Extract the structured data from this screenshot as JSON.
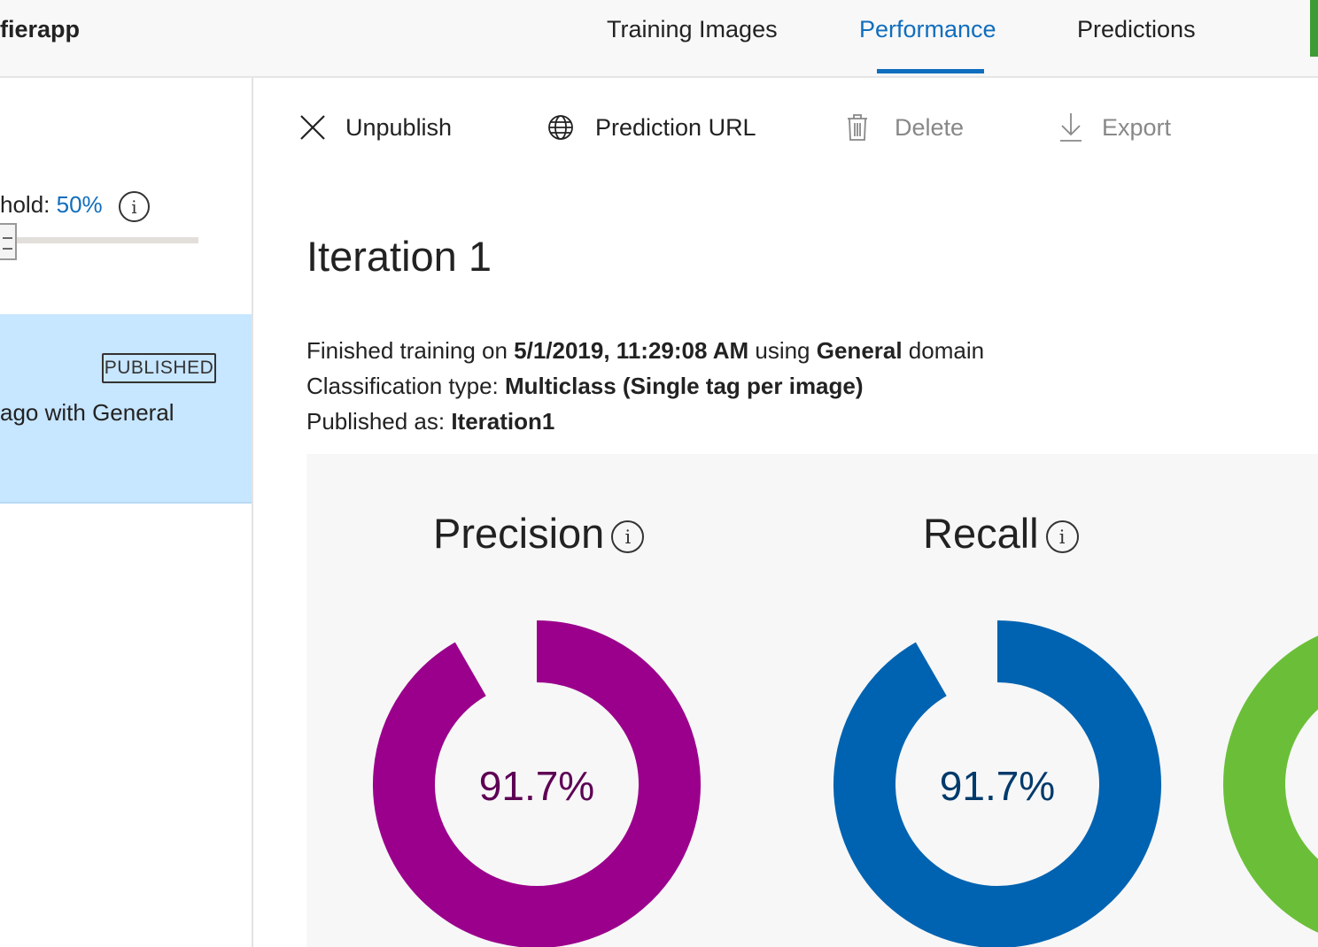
{
  "app": {
    "name": "fierapp"
  },
  "nav": {
    "tabs": [
      {
        "label": "Training Images"
      },
      {
        "label": "Performance"
      },
      {
        "label": "Predictions"
      }
    ]
  },
  "sidebar": {
    "threshold_label": "hold: ",
    "threshold_value": "50%",
    "threshold_percent": 50,
    "info_icon": "i",
    "iteration": {
      "badge": "PUBLISHED",
      "text": "ago with General"
    }
  },
  "toolbar": {
    "unpublish": "Unpublish",
    "prediction_url": "Prediction URL",
    "delete": "Delete",
    "export": "Export"
  },
  "main": {
    "title": "Iteration 1",
    "line1_prefix": "Finished training on ",
    "line1_date": "5/1/2019, 11:29:08 AM",
    "line1_mid": " using ",
    "line1_domain": "General",
    "line1_suffix": " domain",
    "line2_prefix": "Classification type: ",
    "line2_value": "Multiclass (Single tag per image)",
    "line3_prefix": "Published as: ",
    "line3_value": "Iteration1"
  },
  "metrics": {
    "precision": {
      "label": "Precision",
      "value": 91.7,
      "display": "91.7%",
      "color": "#9b008c",
      "text_color": "#5e0055"
    },
    "recall": {
      "label": "Recall",
      "value": 91.7,
      "display": "91.7%",
      "color": "#0063b1",
      "text_color": "#003a6b"
    },
    "third_color": "#6bbf38"
  },
  "colors": {
    "accent": "#106ebe",
    "selected_card": "#c7e6ff"
  }
}
